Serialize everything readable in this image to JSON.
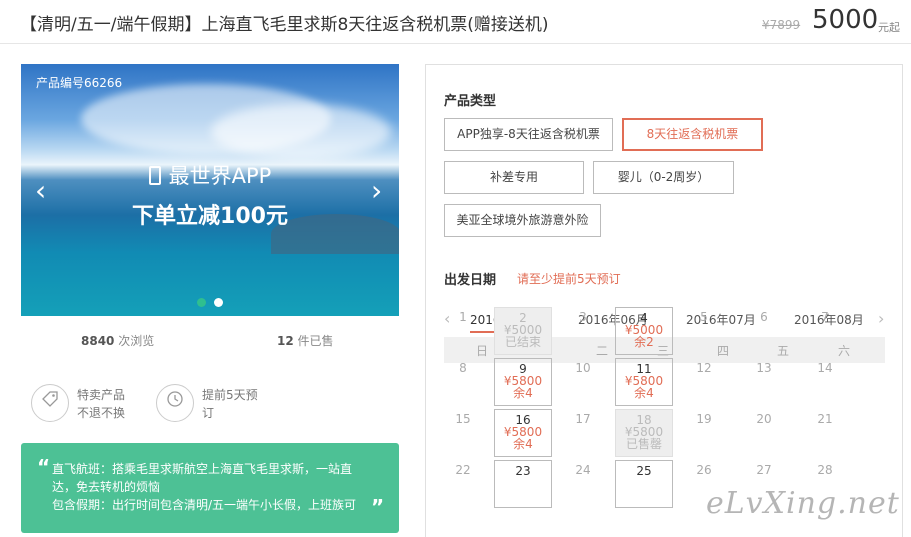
{
  "header": {
    "title": "【清明/五一/端午假期】上海直飞毛里求斯8天往返含税机票(赠接送机)",
    "old_price": "¥7899",
    "price": "5000",
    "price_unit": "元起"
  },
  "banner": {
    "product_code": "产品编号66266",
    "app_line": "最世界APP",
    "promo": "下单立减100元",
    "prev_arrow": "‹",
    "next_arrow": "›"
  },
  "stats": {
    "views_count": "8840",
    "views_label": " 次浏览",
    "sold_count": "12",
    "sold_label": " 件已售"
  },
  "features": [
    {
      "line1": "特卖产品",
      "line2": "不退不换"
    },
    {
      "line1": "提前5天预",
      "line2": "订"
    }
  ],
  "notes": {
    "line1": "直飞航班：搭乘毛里求斯航空上海直飞毛里求斯，一站直达，免去转机的烦恼",
    "line2": "包含假期：出行时间包含清明/五一端午小长假，上班族可"
  },
  "product_type": {
    "label": "产品类型",
    "options": [
      {
        "label": "APP独享-8天往返含税机票"
      },
      {
        "label": "8天往返含税机票"
      },
      {
        "label": "补差专用"
      },
      {
        "label": "婴儿（0-2周岁）"
      },
      {
        "label": "美亚全球境外旅游意外险"
      }
    ],
    "selected": "8天往返含税机票"
  },
  "departure": {
    "label": "出发日期",
    "hint": "请至少提前5天预订"
  },
  "calendar": {
    "months": [
      "2016年05月",
      "2016年06月",
      "2016年07月",
      "2016年08月"
    ],
    "active_month": "2016年05月",
    "weekdays": [
      "日",
      "一",
      "二",
      "三",
      "四",
      "五",
      "六"
    ],
    "rows": [
      [
        {
          "d": "1"
        },
        {
          "d": "2",
          "p": "¥5000",
          "s": "已结束",
          "t": "ended"
        },
        {
          "d": "3"
        },
        {
          "d": "4",
          "p": "¥5000",
          "s": "余2",
          "t": "avail"
        },
        {
          "d": "5"
        },
        {
          "d": "6"
        },
        {
          "d": "7"
        }
      ],
      [
        {
          "d": "8"
        },
        {
          "d": "9",
          "p": "¥5800",
          "s": "余4",
          "t": "avail"
        },
        {
          "d": "10"
        },
        {
          "d": "11",
          "p": "¥5800",
          "s": "余4",
          "t": "avail"
        },
        {
          "d": "12"
        },
        {
          "d": "13"
        },
        {
          "d": "14"
        }
      ],
      [
        {
          "d": "15"
        },
        {
          "d": "16",
          "p": "¥5800",
          "s": "余4",
          "t": "avail"
        },
        {
          "d": "17"
        },
        {
          "d": "18",
          "p": "¥5800",
          "s": "已售罄",
          "t": "soldout"
        },
        {
          "d": "19"
        },
        {
          "d": "20"
        },
        {
          "d": "21"
        }
      ],
      [
        {
          "d": "22"
        },
        {
          "d": "23",
          "t": "avail"
        },
        {
          "d": "24"
        },
        {
          "d": "25",
          "t": "avail"
        },
        {
          "d": "26"
        },
        {
          "d": "27"
        },
        {
          "d": "28"
        }
      ]
    ]
  },
  "watermark": "eLvXing.net"
}
